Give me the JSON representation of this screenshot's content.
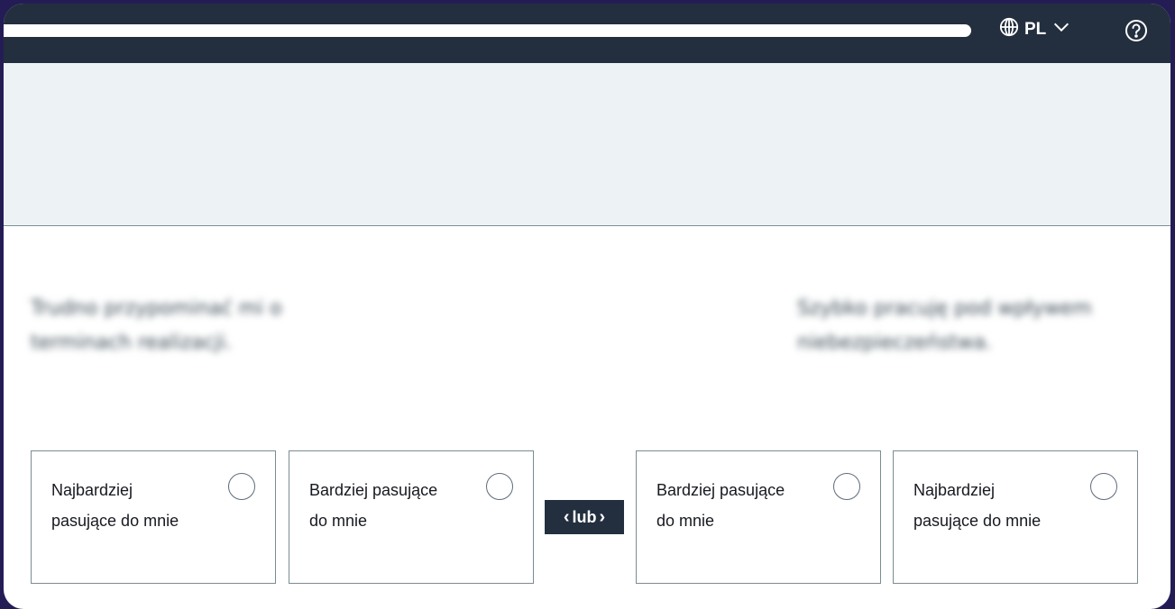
{
  "header": {
    "progress_fraction": 1.0,
    "language": "PL",
    "icons": {
      "language": "globe-icon",
      "dropdown": "chevron-down-icon",
      "help": "help-circle-icon"
    }
  },
  "statements": {
    "left": "Trudno przypominać mi o terminach realizacji.",
    "right": "Szybko pracuję pod wpływem niebezpieczeństwa."
  },
  "divider_label": "lub",
  "options": [
    {
      "label": "Najbardziej pasujące do mnie",
      "selected": false
    },
    {
      "label": "Bardziej pasujące do mnie",
      "selected": false
    },
    {
      "label": "Bardziej pasujące do mnie",
      "selected": false
    },
    {
      "label": "Najbardziej pasujące do mnie",
      "selected": false
    }
  ],
  "colors": {
    "background": "#241d55",
    "topbar": "#232f3e",
    "banner": "#edf3f5",
    "accent_dark": "#232f3e"
  }
}
